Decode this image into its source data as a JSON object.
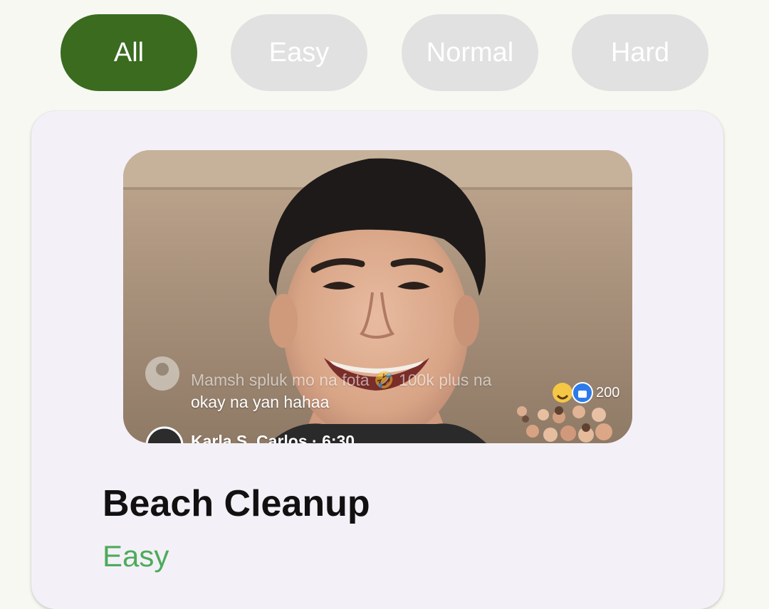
{
  "filters": {
    "items": [
      {
        "label": "All",
        "active": true
      },
      {
        "label": "Easy",
        "active": false
      },
      {
        "label": "Normal",
        "active": false
      },
      {
        "label": "Hard",
        "active": false
      }
    ],
    "active_color": "#3a6b1f",
    "inactive_color": "#e1e1e1"
  },
  "challenge": {
    "title": "Beach Cleanup",
    "difficulty": "Easy",
    "difficulty_color": "#4cab5a",
    "thumbnail": {
      "comment_line_1": "Mamsh spluk mo na fota 🤣 100k plus na",
      "comment_line_2": "okay na yan hahaa",
      "commenter": "Karla S. Carlos · 6:30",
      "reaction_count": "200"
    }
  }
}
